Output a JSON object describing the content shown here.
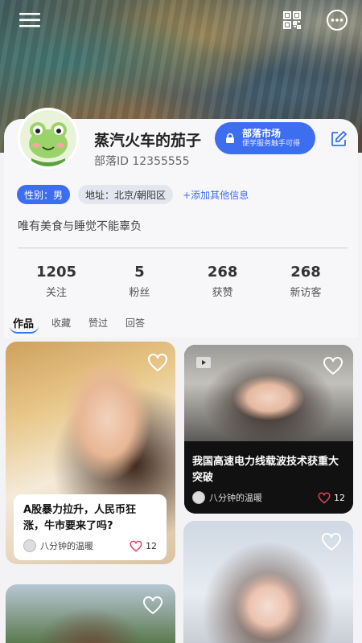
{
  "profile": {
    "nickname": "蒸汽火车的茄子",
    "tribe_id": "部落ID 12355555",
    "bio": "唯有美食与睡觉不能辜负",
    "tags": {
      "gender": "性别：男",
      "location": "地址：北京/朝阳区",
      "add_info": "+添加其他信息"
    }
  },
  "market_button": {
    "title": "部落市场",
    "subtitle": "便学服务触手可得"
  },
  "stats": [
    {
      "value": "1205",
      "label": "关注"
    },
    {
      "value": "5",
      "label": "粉丝"
    },
    {
      "value": "268",
      "label": "获赞"
    },
    {
      "value": "268",
      "label": "新访客"
    }
  ],
  "tabs": [
    "作品",
    "收藏",
    "赞过",
    "回答"
  ],
  "feed": [
    {
      "title": "A股暴力拉升，人民币狂涨，牛市要来了吗?",
      "author": "八分钟的温暖",
      "likes": "12"
    },
    {
      "title": "我国高速电力线载波技术获重大突破",
      "author": "八分钟的温暖",
      "likes": "12"
    }
  ],
  "icons": [
    "menu-icon",
    "qr-code-icon",
    "more-icon",
    "lock-icon",
    "edit-icon",
    "heart-icon",
    "play-icon"
  ],
  "colors": {
    "accent": "#3d6ef0",
    "like": "#e0445b"
  }
}
